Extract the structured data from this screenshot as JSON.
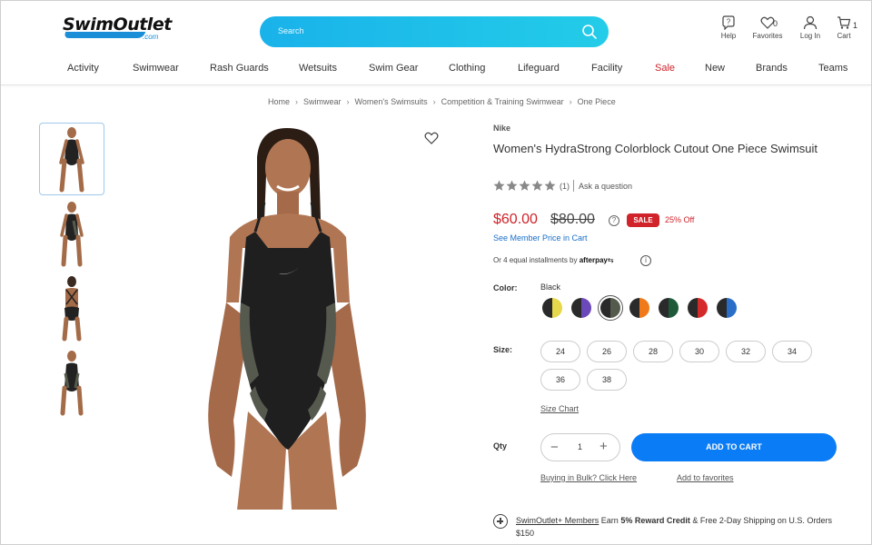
{
  "header": {
    "logo_text": "SwimOutlet",
    "logo_suffix": ".com",
    "search_placeholder": "Search",
    "help_label": "Help",
    "favorites_label": "Favorites",
    "favorites_count": "0",
    "login_label": "Log In",
    "cart_label": "Cart",
    "cart_count": "1"
  },
  "nav": {
    "items": [
      "Activity",
      "Swimwear",
      "Rash Guards",
      "Wetsuits",
      "Swim Gear",
      "Clothing",
      "Lifeguard",
      "Facility",
      "Sale",
      "New",
      "Brands",
      "Teams"
    ]
  },
  "breadcrumb": [
    "Home",
    "Swimwear",
    "Women's Swimsuits",
    "Competition & Training Swimwear",
    "One Piece"
  ],
  "product": {
    "brand": "Nike",
    "title": "Women's HydraStrong Colorblock Cutout One Piece Swimsuit",
    "rating": 0,
    "rating_count": "(1)",
    "ask_question": "Ask a question",
    "price": "$60.00",
    "old_price": "$80.00",
    "sale_badge": "SALE",
    "percent_off": "25% Off",
    "member_price": "See Member Price in Cart",
    "installments_prefix": "Or 4 equal installments by",
    "installments_brand": "afterpay",
    "color_label": "Color:",
    "color_value": "Black",
    "swatches": [
      {
        "name": "black-yellow",
        "left": "#2a2a2a",
        "right": "#e6d84a"
      },
      {
        "name": "black-purple",
        "left": "#2a2a2a",
        "right": "#6b49b8"
      },
      {
        "name": "black",
        "left": "#2a2a2a",
        "right": "#555b4c",
        "selected": true
      },
      {
        "name": "black-orange",
        "left": "#2a2a2a",
        "right": "#f07a1a"
      },
      {
        "name": "black-green",
        "left": "#2a2a2a",
        "right": "#1e5a3a"
      },
      {
        "name": "black-red",
        "left": "#2a2a2a",
        "right": "#d42a2a"
      },
      {
        "name": "black-blue",
        "left": "#2a2a2a",
        "right": "#2a6ec8"
      }
    ],
    "size_label": "Size:",
    "sizes": [
      "24",
      "26",
      "28",
      "30",
      "32",
      "34",
      "36",
      "38"
    ],
    "size_chart": "Size Chart",
    "qty_label": "Qty",
    "qty_value": "1",
    "qty_minus": "−",
    "qty_plus": "+",
    "add_to_cart": "ADD TO CART",
    "bulk": "Buying in Bulk? Click Here",
    "add_to_favorites": "Add to favorites",
    "promo_link": "SwimOutlet+ Members",
    "promo_earn": "Earn",
    "promo_bold": "5% Reward Credit",
    "promo_rest": "& Free 2-Day Shipping on U.S. Orders $150"
  },
  "colors": {
    "accent_blue": "#0a7cf5",
    "search_gradient_start": "#19b2ea",
    "sale_red": "#d0232a"
  }
}
